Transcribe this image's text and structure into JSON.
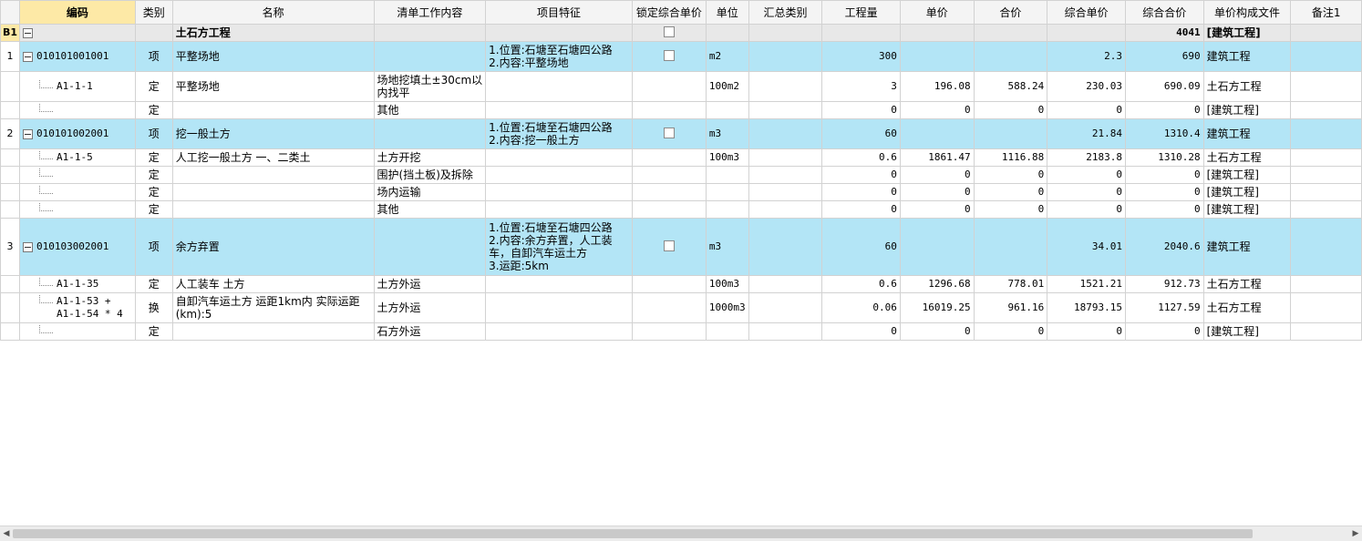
{
  "headers": [
    "",
    "编码",
    "类别",
    "名称",
    "清单工作内容",
    "项目特征",
    "锁定综合单价",
    "单位",
    "汇总类别",
    "工程量",
    "单价",
    "合价",
    "综合单价",
    "综合合价",
    "单价构成文件",
    "备注1"
  ],
  "rows": [
    {
      "type": "group",
      "rn": "B1",
      "code": "",
      "cat": "",
      "name": "土石方工程",
      "work": "",
      "feat": [],
      "lock": true,
      "unit": "",
      "sum": "",
      "qty": "",
      "price": "",
      "total": "",
      "uprice": "",
      "utotal": "4041",
      "file": "[建筑工程]",
      "note": ""
    },
    {
      "type": "item",
      "rn": "1",
      "code": "010101001001",
      "cat": "项",
      "name": "平整场地",
      "work": "",
      "feat": [
        "1.位置:石塘至石塘四公路",
        "2.内容:平整场地"
      ],
      "lock": true,
      "unit": "m2",
      "sum": "",
      "qty": "300",
      "price": "",
      "total": "",
      "uprice": "2.3",
      "utotal": "690",
      "file": "建筑工程",
      "note": ""
    },
    {
      "type": "sub",
      "rn": "",
      "code": "A1-1-1",
      "cat": "定",
      "name": "平整场地",
      "work": [
        "场地挖填土±30cm以",
        "内找平"
      ],
      "feat": [],
      "lock": false,
      "unit": "100m2",
      "sum": "",
      "qty": "3",
      "price": "196.08",
      "total": "588.24",
      "uprice": "230.03",
      "utotal": "690.09",
      "file": "土石方工程",
      "note": ""
    },
    {
      "type": "sub",
      "rn": "",
      "code": "",
      "cat": "定",
      "name": "",
      "work": "其他",
      "feat": [],
      "lock": false,
      "unit": "",
      "sum": "",
      "qty": "0",
      "price": "0",
      "total": "0",
      "uprice": "0",
      "utotal": "0",
      "file": "[建筑工程]",
      "note": ""
    },
    {
      "type": "item",
      "rn": "2",
      "code": "010101002001",
      "cat": "项",
      "name": "挖一般土方",
      "work": "",
      "feat": [
        "1.位置:石塘至石塘四公路",
        "2.内容:挖一般土方"
      ],
      "lock": true,
      "unit": "m3",
      "sum": "",
      "qty": "60",
      "price": "",
      "total": "",
      "uprice": "21.84",
      "utotal": "1310.4",
      "file": "建筑工程",
      "note": ""
    },
    {
      "type": "sub",
      "rn": "",
      "code": "A1-1-5",
      "cat": "定",
      "name": "人工挖一般土方 一、二类土",
      "work": "土方开挖",
      "feat": [],
      "lock": false,
      "unit": "100m3",
      "sum": "",
      "qty": "0.6",
      "price": "1861.47",
      "total": "1116.88",
      "uprice": "2183.8",
      "utotal": "1310.28",
      "file": "土石方工程",
      "note": ""
    },
    {
      "type": "sub",
      "rn": "",
      "code": "",
      "cat": "定",
      "name": "",
      "work": "围护(挡土板)及拆除",
      "feat": [],
      "lock": false,
      "unit": "",
      "sum": "",
      "qty": "0",
      "price": "0",
      "total": "0",
      "uprice": "0",
      "utotal": "0",
      "file": "[建筑工程]",
      "note": ""
    },
    {
      "type": "sub",
      "rn": "",
      "code": "",
      "cat": "定",
      "name": "",
      "work": "场内运输",
      "feat": [],
      "lock": false,
      "unit": "",
      "sum": "",
      "qty": "0",
      "price": "0",
      "total": "0",
      "uprice": "0",
      "utotal": "0",
      "file": "[建筑工程]",
      "note": ""
    },
    {
      "type": "sub",
      "rn": "",
      "code": "",
      "cat": "定",
      "name": "",
      "work": "其他",
      "feat": [],
      "lock": false,
      "unit": "",
      "sum": "",
      "qty": "0",
      "price": "0",
      "total": "0",
      "uprice": "0",
      "utotal": "0",
      "file": "[建筑工程]",
      "note": ""
    },
    {
      "type": "item",
      "rn": "3",
      "code": "010103002001",
      "cat": "项",
      "name": "余方弃置",
      "work": "",
      "feat": [
        "1.位置:石塘至石塘四公路",
        "2.内容:余方弃置，人工装",
        "车，自卸汽车运土方",
        "3.运距:5km"
      ],
      "lock": true,
      "unit": "m3",
      "sum": "",
      "qty": "60",
      "price": "",
      "total": "",
      "uprice": "34.01",
      "utotal": "2040.6",
      "file": "建筑工程",
      "note": ""
    },
    {
      "type": "sub",
      "rn": "",
      "code": "A1-1-35",
      "cat": "定",
      "name": "人工装车 土方",
      "work": "土方外运",
      "feat": [],
      "lock": false,
      "unit": "100m3",
      "sum": "",
      "qty": "0.6",
      "price": "1296.68",
      "total": "778.01",
      "uprice": "1521.21",
      "utotal": "912.73",
      "file": "土石方工程",
      "note": ""
    },
    {
      "type": "sub",
      "rn": "",
      "code": [
        "A1-1-53 +",
        "A1-1-54 * 4"
      ],
      "cat": "换",
      "name": [
        "自卸汽车运土方 运距1km内  实际运距",
        "(km):5"
      ],
      "work": "土方外运",
      "feat": [],
      "lock": false,
      "unit": "1000m3",
      "sum": "",
      "qty": "0.06",
      "price": "16019.25",
      "total": "961.16",
      "uprice": "18793.15",
      "utotal": "1127.59",
      "file": "土石方工程",
      "note": ""
    },
    {
      "type": "sub",
      "rn": "",
      "code": "",
      "cat": "定",
      "name": "",
      "work": "石方外运",
      "feat": [],
      "lock": false,
      "unit": "",
      "sum": "",
      "qty": "0",
      "price": "0",
      "total": "0",
      "uprice": "0",
      "utotal": "0",
      "file": "[建筑工程]",
      "note": ""
    }
  ]
}
